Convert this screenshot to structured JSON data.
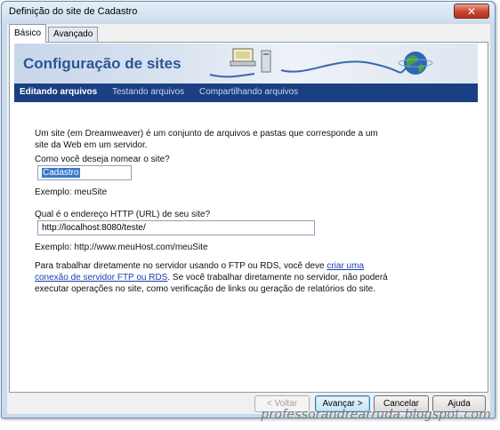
{
  "window": {
    "title": "Definição do site de Cadastro",
    "close_glyph": "✕"
  },
  "tabs": [
    {
      "label": "Básico",
      "active": true
    },
    {
      "label": "Avançado",
      "active": false
    }
  ],
  "banner": {
    "title": "Configuração de sites",
    "art_icons": [
      "server-icon",
      "computer-icon",
      "globe-icon"
    ]
  },
  "steps": [
    {
      "label": "Editando arquivos",
      "active": true
    },
    {
      "label": "Testando arquivos",
      "active": false
    },
    {
      "label": "Compartilhando arquivos",
      "active": false
    }
  ],
  "form": {
    "intro": "Um site (em Dreamweaver) é um conjunto de arquivos e pastas que corresponde a um site da Web em um servidor.",
    "name_question": "Como você deseja nomear o site?",
    "name_value": "Cadastro",
    "name_example": "Exemplo: meuSite",
    "url_question": "Qual é o endereço HTTP (URL) de seu site?",
    "url_value": "http://localhost:8080/teste/",
    "url_example": "Exemplo: http://www.meuHost.com/meuSite",
    "info_before": "Para trabalhar diretamente no servidor usando o FTP ou RDS, você deve ",
    "info_link": "criar uma conexão de servidor FTP ou RDS",
    "info_after": ". Se você trabalhar diretamente no servidor, não poderá executar operações no site, como verificação de links ou geração de relatórios do site."
  },
  "buttons": {
    "back": "< Voltar",
    "next": "Avançar >",
    "cancel": "Cancelar",
    "help": "Ajuda"
  },
  "watermark": "professorandrearruda.blogspot.com",
  "colors": {
    "nav_bg": "#1a3f82",
    "banner_title": "#2c5596",
    "link": "#1a3fb0",
    "selection": "#3d78c7"
  }
}
